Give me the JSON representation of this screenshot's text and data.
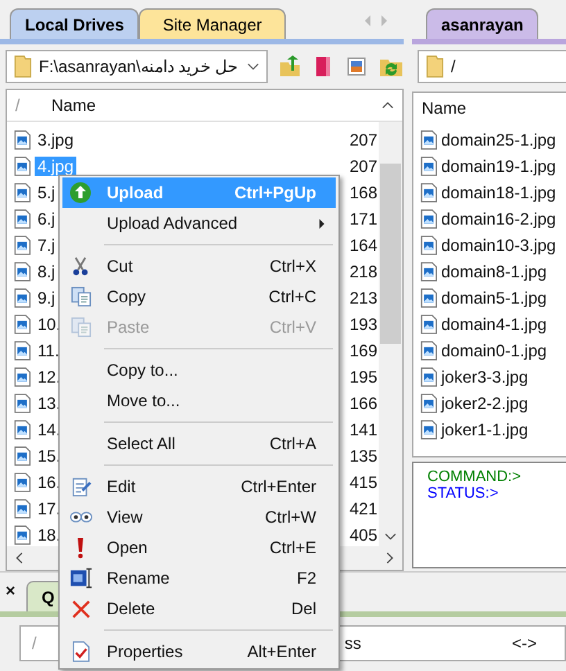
{
  "left_panel": {
    "tabs": [
      {
        "label": "Local Drives",
        "selected": true
      },
      {
        "label": "Site Manager",
        "selected": false
      }
    ],
    "path": "F:\\asanrayan\\حل خرید دامنه",
    "list_header": {
      "sort_mark": "/",
      "name": "Name"
    },
    "files": [
      {
        "name": "3.jpg",
        "size": "207",
        "selected": false
      },
      {
        "name": "4.jpg",
        "size": "207",
        "selected": true
      },
      {
        "name": "5.j",
        "size": "168",
        "selected": false
      },
      {
        "name": "6.j",
        "size": "171",
        "selected": false
      },
      {
        "name": "7.j",
        "size": "164",
        "selected": false
      },
      {
        "name": "8.j",
        "size": "218",
        "selected": false
      },
      {
        "name": "9.j",
        "size": "213",
        "selected": false
      },
      {
        "name": "10.",
        "size": "193",
        "selected": false
      },
      {
        "name": "11.",
        "size": "169",
        "selected": false
      },
      {
        "name": "12.",
        "size": "195",
        "selected": false
      },
      {
        "name": "13.",
        "size": "166",
        "selected": false
      },
      {
        "name": "14.",
        "size": "141",
        "selected": false
      },
      {
        "name": "15.",
        "size": "135",
        "selected": false
      },
      {
        "name": "16.",
        "size": "415",
        "selected": false
      },
      {
        "name": "17.",
        "size": "421",
        "selected": false
      },
      {
        "name": "18.",
        "size": "405",
        "selected": false
      }
    ]
  },
  "right_panel": {
    "tabs": [
      {
        "label": "asanrayan",
        "selected": true
      }
    ],
    "path": "/",
    "list_header": {
      "name": "Name"
    },
    "files": [
      {
        "name": "domain25-1.jpg"
      },
      {
        "name": "domain19-1.jpg"
      },
      {
        "name": "domain18-1.jpg"
      },
      {
        "name": "domain16-2.jpg"
      },
      {
        "name": "domain10-3.jpg"
      },
      {
        "name": "domain8-1.jpg"
      },
      {
        "name": "domain5-1.jpg"
      },
      {
        "name": "domain4-1.jpg"
      },
      {
        "name": "domain0-1.jpg"
      },
      {
        "name": "joker3-3.jpg"
      },
      {
        "name": "joker2-2.jpg"
      },
      {
        "name": "joker1-1.jpg"
      }
    ],
    "log": [
      {
        "text": "COMMAND:>",
        "color": "#008000"
      },
      {
        "text": "STATUS:>",
        "color": "#0000ff"
      }
    ]
  },
  "queue": {
    "close": "×",
    "tab": "Q",
    "header": {
      "sort_mark": "/",
      "column_2": "ss",
      "column_3": "<->"
    }
  },
  "context_menu": [
    {
      "kind": "item",
      "label": "Upload",
      "shortcut": "Ctrl+PgUp",
      "selected": true,
      "disabled": false,
      "submenu": false
    },
    {
      "kind": "item",
      "label": "Upload Advanced",
      "selected": false,
      "disabled": false,
      "submenu": true
    },
    {
      "kind": "separator"
    },
    {
      "kind": "item",
      "label": "Cut",
      "shortcut": "Ctrl+X",
      "selected": false,
      "disabled": false,
      "submenu": false
    },
    {
      "kind": "item",
      "label": "Copy",
      "shortcut": "Ctrl+C",
      "selected": false,
      "disabled": false,
      "submenu": false
    },
    {
      "kind": "item",
      "label": "Paste",
      "shortcut": "Ctrl+V",
      "selected": false,
      "disabled": true,
      "submenu": false
    },
    {
      "kind": "separator"
    },
    {
      "kind": "item",
      "label": "Copy to...",
      "selected": false,
      "disabled": false,
      "submenu": false
    },
    {
      "kind": "item",
      "label": "Move to...",
      "selected": false,
      "disabled": false,
      "submenu": false
    },
    {
      "kind": "separator"
    },
    {
      "kind": "item",
      "label": "Select All",
      "shortcut": "Ctrl+A",
      "selected": false,
      "disabled": false,
      "submenu": false
    },
    {
      "kind": "separator"
    },
    {
      "kind": "item",
      "label": "Edit",
      "shortcut": "Ctrl+Enter",
      "selected": false,
      "disabled": false,
      "submenu": false
    },
    {
      "kind": "item",
      "label": "View",
      "shortcut": "Ctrl+W",
      "selected": false,
      "disabled": false,
      "submenu": false
    },
    {
      "kind": "item",
      "label": "Open",
      "shortcut": "Ctrl+E",
      "selected": false,
      "disabled": false,
      "submenu": false
    },
    {
      "kind": "item",
      "label": "Rename",
      "shortcut": "F2",
      "selected": false,
      "disabled": false,
      "submenu": false
    },
    {
      "kind": "item",
      "label": "Delete",
      "shortcut": "Del",
      "selected": false,
      "disabled": false,
      "submenu": false
    },
    {
      "kind": "separator"
    },
    {
      "kind": "item",
      "label": "Properties",
      "shortcut": "Alt+Enter",
      "selected": false,
      "disabled": false,
      "submenu": false
    }
  ]
}
